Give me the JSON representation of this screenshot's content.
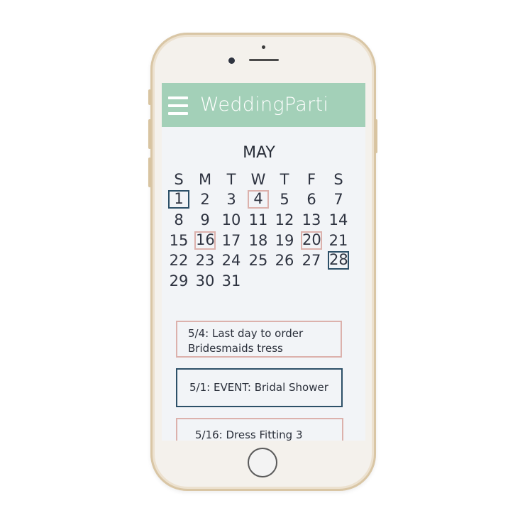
{
  "app": {
    "title": "WeddingParti"
  },
  "calendar": {
    "month": "MAY",
    "weekdays": [
      "S",
      "M",
      "T",
      "W",
      "T",
      "F",
      "S"
    ],
    "weeks": [
      [
        "1",
        "2",
        "3",
        "4",
        "5",
        "6",
        "7"
      ],
      [
        "8",
        "9",
        "10",
        "11",
        "12",
        "13",
        "14"
      ],
      [
        "15",
        "16",
        "17",
        "18",
        "19",
        "20",
        "21"
      ],
      [
        "22",
        "23",
        "24",
        "25",
        "26",
        "27",
        "28"
      ],
      [
        "29",
        "30",
        "31"
      ]
    ],
    "highlights": {
      "1": "navy",
      "4": "pink",
      "16": "pink",
      "20": "pink",
      "28": "navy"
    }
  },
  "events": [
    {
      "text": "5/4: Last day to order Bridesmaids tress",
      "style": "pink"
    },
    {
      "text": "5/1: EVENT: Bridal Shower",
      "style": "navy"
    },
    {
      "text": "5/16: Dress Fitting 3",
      "style": "pink"
    }
  ],
  "colors": {
    "appbar": "#a3d0b8",
    "pink": "#dcb1ac",
    "navy": "#2d5068",
    "screen": "#f2f4f7"
  }
}
